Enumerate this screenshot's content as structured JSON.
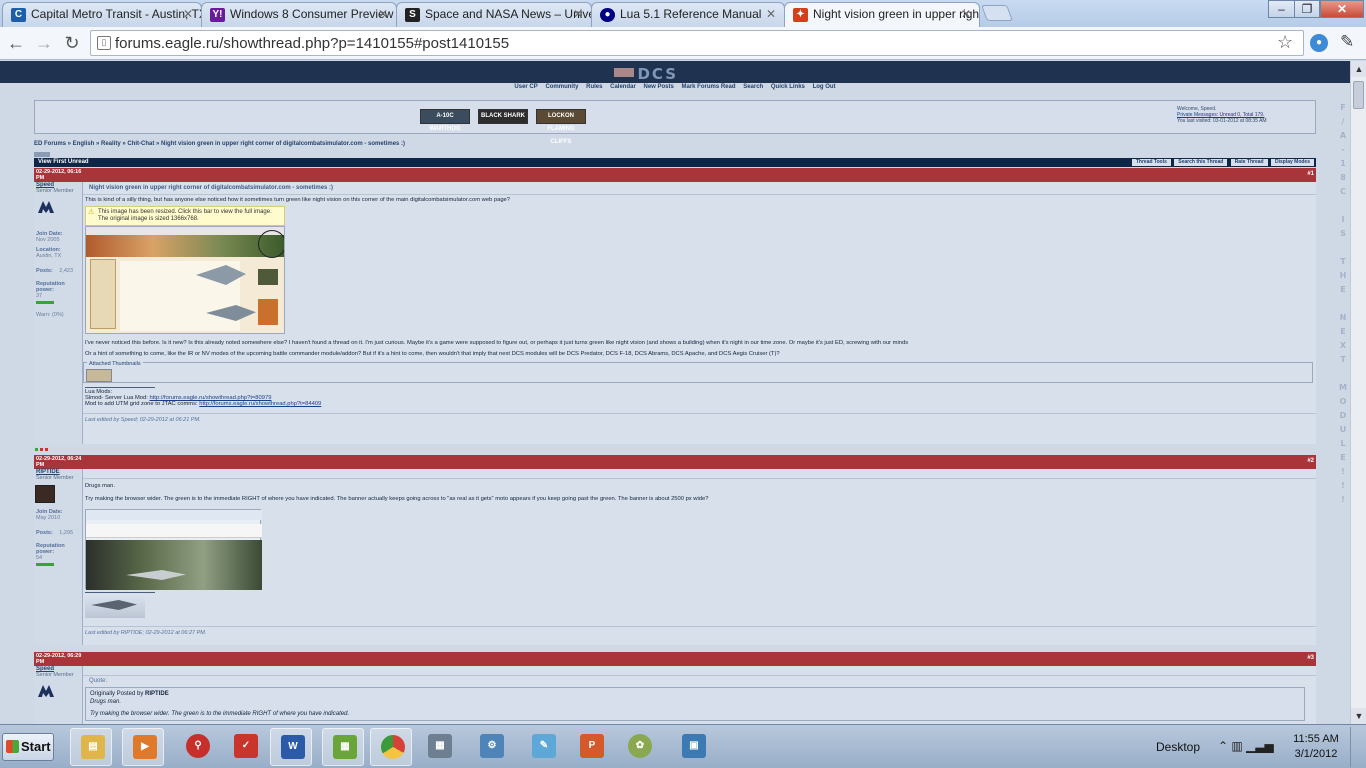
{
  "browser": {
    "tabs": [
      {
        "title": "Capital Metro Transit - Austin, TX",
        "favicon": "capmetro-icon",
        "color": "#1c5fa6",
        "active": false
      },
      {
        "title": "Windows 8 Consumer Preview",
        "favicon": "yahoo-icon",
        "color": "#6a1b9a",
        "active": false
      },
      {
        "title": "Space and NASA News – Universe Today",
        "favicon": "nasa-icon",
        "color": "#222222",
        "active": false
      },
      {
        "title": "Lua 5.1 Reference Manual",
        "favicon": "lua-icon",
        "color": "#000080",
        "active": false
      },
      {
        "title": "Night vision green in upper right corner",
        "favicon": "eagle-icon",
        "color": "#d0401b",
        "active": true
      }
    ],
    "url": "forums.eagle.ru/showthread.php?p=1410155#post1410155",
    "window_buttons": {
      "minimize": "–",
      "maximize": "❐",
      "close": "✕"
    }
  },
  "forum": {
    "logo": "DCS",
    "navlinks": [
      "User CP",
      "Community",
      "Rules",
      "Calendar",
      "New Posts",
      "Mark Forums Read",
      "Search",
      "Quick Links",
      "Log Out"
    ],
    "header_images": [
      {
        "label": "A-10C WARTHOG",
        "color": "#3a4c5e"
      },
      {
        "label": "BLACK SHARK",
        "color": "#2d2d2d"
      },
      {
        "label": "LOCKON FLAMING CLIFFS",
        "color": "#5a4a33"
      }
    ],
    "welcome": {
      "line1": "Welcome, Speed.",
      "line2": "Private Messages: Unread 0, Total 179.",
      "line3": "You last visited: 03-01-2012 at 08:35 AM"
    },
    "breadcrumb": "ED Forums » English » Reality » Chit-Chat » Night vision green in upper right corner of digitalcombatsimulator.com - sometimes :)",
    "view_first_unread": "View First Unread",
    "thread_tools": [
      "Thread Tools",
      "Search this Thread",
      "Rate Thread",
      "Display Modes"
    ],
    "sidetext": "F\n/\nA\n-\n1\n8\nC\n\nI\nS\n\nT\nH\nE\n\nN\nE\nX\nT\n\nM\nO\nD\nU\nL\nE\n!\n!\n!"
  },
  "posts": [
    {
      "date": "02-29-2012, 06:16 PM",
      "num": "#1",
      "user": "Speed",
      "usertitle": "Senior Member",
      "join_label": "Join Date:",
      "join": "Nov 2005",
      "location_label": "Location:",
      "location": "Austin, TX",
      "posts_label": "Posts:",
      "posts": "2,423",
      "rep_label": "Reputation power:",
      "rep": "37",
      "warn": "Warn: (0%)",
      "title": "Night vision green in upper right corner of digitalcombatsimulator.com - sometimes :)",
      "text1": "This is kind of a silly thing, but has anyone else noticed how it sometimes turn green like night vision on this corner of the main digitalcombatsimulator.com web page?",
      "notice": "This image has been resized. Click this bar to view the full image. The original image is sized 1366x768.",
      "text2": "I've never noticed this before. Is it new? Is this already noted somewhere else? I haven't found a thread on it. I'm just curious. Maybe it's a game were supposed to figure out, or perhaps it just turns green like night vision (and shows a building) when it's night in our time zone. Or maybe it's just ED, screwing with our minds",
      "text3": "Or a hint of something to come, like the IR or NV modes of the upcoming battle commander module/addon? But if it's a hint to come, then wouldn't that imply that next DCS modules will be DCS Predator, DCS F-18, DCS Abrams, DCS Apache, and DCS Aegis Cruiser (T)?",
      "attached": "Attached Thumbnails",
      "sig1": "Lua Mods:",
      "sig2_label": "Slmod- Server Lua Mod:",
      "sig2_link": "http://forums.eagle.ru/showthread.php?t=80979",
      "sig3_label": "Mod to add UTM grid zone to JTAC comms:",
      "sig3_link": "http://forums.eagle.ru/showthread.php?t=84409",
      "edited": "Last edited by Speed; 02-29-2012 at 06:21 PM."
    },
    {
      "date": "02-29-2012, 06:24 PM",
      "num": "#2",
      "user": "RIPTIDE",
      "usertitle": "Senior Member",
      "join_label": "Join Date:",
      "join": "May 2010",
      "posts_label": "Posts:",
      "posts": "1,295",
      "rep_label": "Reputation power:",
      "rep": "54",
      "text1": "Drugs man.",
      "text2": "Try making the browser wider. The green is to the immediate RIGHT of where you have indicated. The banner actually keeps going across to \"as real as it gets\" moto appears if you keep going past the green. The banner is about 2500 px wide?",
      "edited": "Last edited by RIPTIDE; 02-29-2012 at 06:27 PM."
    },
    {
      "date": "02-29-2012, 06:29 PM",
      "num": "#3",
      "user": "Speed",
      "usertitle": "Senior Member",
      "quote_label": "Quote:",
      "quote_by_prefix": "Originally Posted by",
      "quote_by": "RIPTIDE",
      "quote_line1": "Drugs man.",
      "quote_line2": "Try making the browser wider. The green is to the immediate RIGHT of where you have indicated."
    }
  ],
  "taskbar": {
    "start": "Start",
    "desktop": "Desktop",
    "time": "11:55 AM",
    "date": "3/1/2012",
    "icons": [
      {
        "name": "file-explorer-icon",
        "color": "#e0b64a",
        "active": true
      },
      {
        "name": "media-player-icon",
        "color": "#e07a2a",
        "active": true
      },
      {
        "name": "pushpin-icon",
        "color": "#c7302a",
        "active": false
      },
      {
        "name": "todoist-icon",
        "color": "#c9352a",
        "active": false
      },
      {
        "name": "word-icon",
        "color": "#2b5aa8",
        "active": true
      },
      {
        "name": "spreadsheet-icon",
        "color": "#6aa53a",
        "active": true
      },
      {
        "name": "chrome-icon",
        "color": "#3b9a3a",
        "active": true
      },
      {
        "name": "calculator-icon",
        "color": "#6f7f92",
        "active": false
      },
      {
        "name": "control-panel-icon",
        "color": "#4e84b8",
        "active": false
      },
      {
        "name": "notepad-icon",
        "color": "#5ea8d8",
        "active": false
      },
      {
        "name": "presentation-icon",
        "color": "#d55a2b",
        "active": false
      },
      {
        "name": "paint-icon",
        "color": "#8aa850",
        "active": false
      },
      {
        "name": "photo-viewer-icon",
        "color": "#3b7ab3",
        "active": false
      }
    ]
  }
}
